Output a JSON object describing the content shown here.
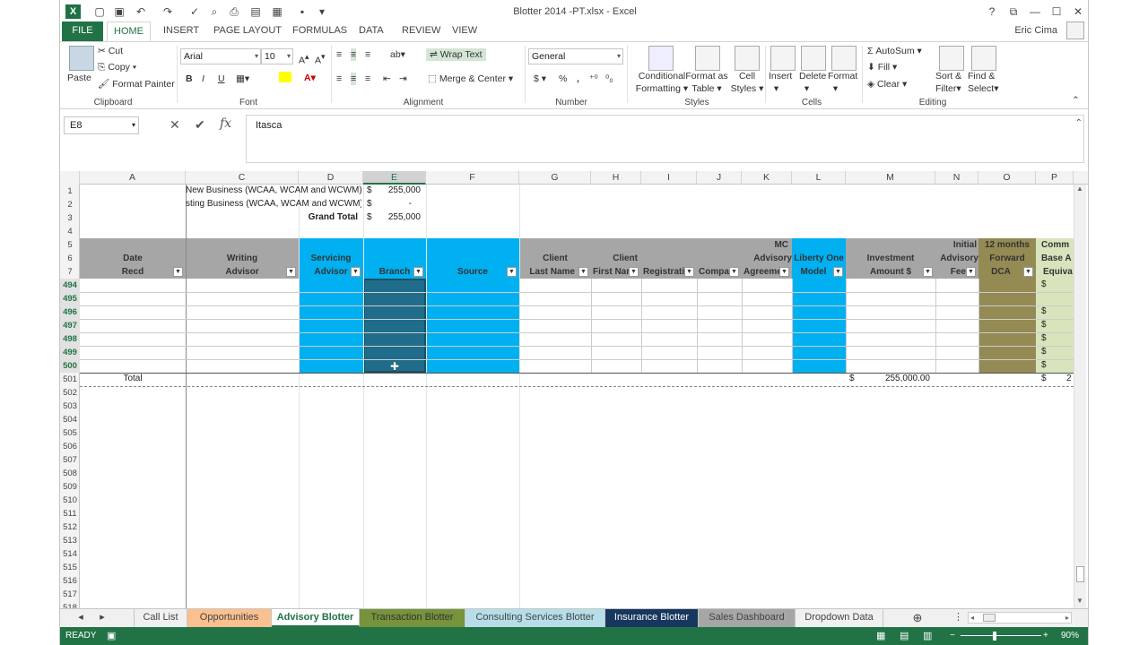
{
  "title": {
    "doc": "Blotter 2014 -PT.xlsx - Excel",
    "help": "?",
    "restore": "⧉",
    "minimize": "—",
    "maximize": "☐",
    "close": "✕"
  },
  "tabs": [
    "FILE",
    "HOME",
    "INSERT",
    "PAGE LAYOUT",
    "FORMULAS",
    "DATA",
    "REVIEW",
    "VIEW"
  ],
  "user": "Eric Cima",
  "ribbon": {
    "clipboard": {
      "paste": "Paste",
      "cut": "Cut",
      "copy": "Copy",
      "format_painter": "Format Painter",
      "label": "Clipboard"
    },
    "font": {
      "name": "Arial",
      "size": "10",
      "bold": "B",
      "italic": "I",
      "underline": "U",
      "label": "Font"
    },
    "alignment": {
      "wrap": "Wrap Text",
      "merge": "Merge & Center",
      "label": "Alignment"
    },
    "number": {
      "format": "General",
      "currency": "$",
      "percent": "%",
      "comma": ",",
      "label": "Number"
    },
    "styles": {
      "conditional": "Conditional",
      "formatting": "Formatting",
      "format_as": "Format as",
      "table": "Table",
      "cell": "Cell",
      "cell_styles": "Styles",
      "label": "Styles"
    },
    "cells": {
      "insert": "Insert",
      "delete": "Delete",
      "format": "Format",
      "label": "Cells"
    },
    "editing": {
      "autosum": "AutoSum",
      "fill": "Fill",
      "clear": "Clear",
      "sort": "Sort &",
      "filter": "Filter",
      "find": "Find &",
      "select": "Select",
      "label": "Editing"
    }
  },
  "formula_bar": {
    "name_box": "E8",
    "cancel": "✕",
    "enter": "✔",
    "fx": "fx",
    "value": "Itasca"
  },
  "columns": [
    "A",
    "C",
    "D",
    "E",
    "F",
    "G",
    "H",
    "I",
    "J",
    "K",
    "L",
    "M",
    "N",
    "O",
    "P"
  ],
  "summary": {
    "r1_label": "New Business (WCAA, WCAM and WCWM)",
    "r1_sym": "$",
    "r1_val": "255,000",
    "r2_label": "sting Business (WCAA, WCAM and WCWM)",
    "r2_sym": "$",
    "r2_val": "-",
    "r3_label": "Grand Total",
    "r3_sym": "$",
    "r3_val": "255,000"
  },
  "headers": {
    "date1": "Date",
    "date2": "Recd",
    "writing1": "Writing",
    "writing2": "Advisor",
    "serv1": "Servicing",
    "serv2": "Advisor",
    "branch": "Branch",
    "source": "Source",
    "cl1": "Client",
    "cl2": "Last Name",
    "cf1": "Client",
    "cf2": "First Nar",
    "reg": "Registrati",
    "comp": "Compa",
    "mc1": "MC",
    "mc2": "Advisory",
    "mc3": "Agreeme",
    "lib1": "Liberty One",
    "lib2": "Model",
    "inv1": "Investment",
    "inv2": "Amount $",
    "fee1": "Initial",
    "fee2": "Advisory",
    "fee3": "Fee",
    "dca1": "12 months",
    "dca2": "Forward",
    "dca3": "DCA",
    "cb1": "Comm",
    "cb2": "Base A",
    "cb3": "Equiva"
  },
  "rows": [
    "1",
    "2",
    "3",
    "4",
    "5",
    "6",
    "7",
    "494",
    "495",
    "496",
    "497",
    "498",
    "499",
    "500",
    "501",
    "502",
    "503",
    "504",
    "505",
    "506",
    "507",
    "508",
    "509",
    "510",
    "511",
    "512",
    "513",
    "514",
    "515",
    "516",
    "517",
    "518"
  ],
  "total_row": {
    "label": "Total",
    "sym": "$",
    "amount": "255,000.00",
    "sym2": "$",
    "trail": "2"
  },
  "dollar": "$",
  "sheets": [
    "Call List",
    "Opportunities",
    "Advisory Blotter",
    "Transaction Blotter",
    "Consulting Services Blotter",
    "Insurance Blotter",
    "Sales Dashboard",
    "Dropdown Data"
  ],
  "status": {
    "ready": "READY",
    "zoom": "90%",
    "minus": "−",
    "plus": "+"
  },
  "colors": {
    "accent": "#217346",
    "cyan": "#00b0f0",
    "teal": "#1f6d8a",
    "olive": "#948a54",
    "lightgreen": "#d8e4bc",
    "gray": "#a6a6a6"
  }
}
